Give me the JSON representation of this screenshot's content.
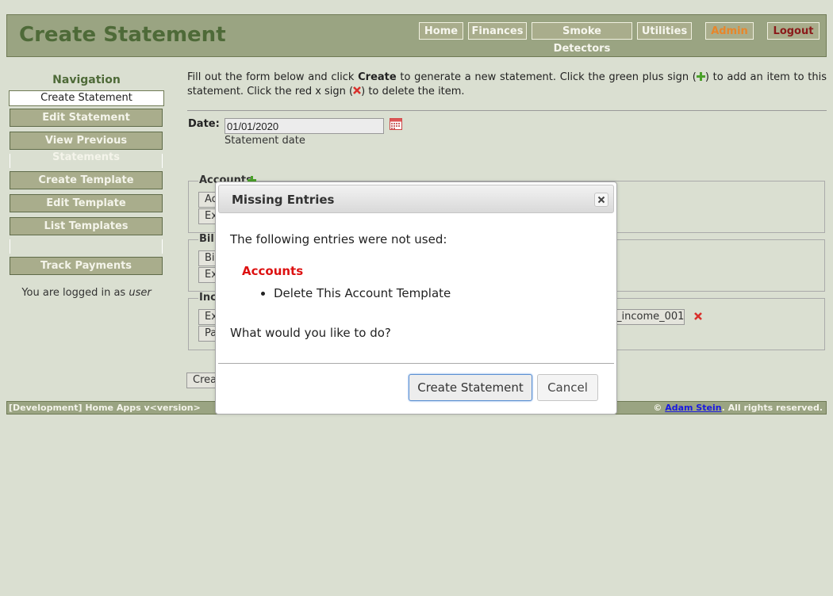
{
  "header": {
    "title": "Create Statement",
    "nav": [
      {
        "label": "Home",
        "color": "#f6f6ee"
      },
      {
        "label": "Finances",
        "color": "#f6f6ee"
      },
      {
        "label": "Smoke Detectors",
        "color": "#f6f6ee"
      },
      {
        "label": "Utilities",
        "color": "#f6f6ee"
      },
      {
        "label": "Admin",
        "color": "#e8862a"
      },
      {
        "label": "Logout",
        "color": "#8b1a1a"
      }
    ]
  },
  "sidebar": {
    "heading": "Navigation",
    "items": [
      {
        "label": "Create Statement",
        "active": true
      },
      {
        "label": "Edit Statement"
      },
      {
        "label": "View Previous Statements"
      },
      {
        "label": "Create Template"
      },
      {
        "label": "Edit Template"
      },
      {
        "label": "List Templates"
      },
      {
        "label": "Track Payments"
      }
    ],
    "logged_in_prefix": "You are logged in as ",
    "logged_in_user": "user"
  },
  "main": {
    "intro": {
      "part1": "Fill out the form below and click ",
      "create_word": "Create",
      "part2": " to generate a new statement. Click the green plus sign (",
      "part3": ") to add an item to this statement. Click the red x sign (",
      "part4": ") to delete the item."
    },
    "date_label": "Date:",
    "date_value": "01/01/2020",
    "date_help": "Statement date",
    "groups": {
      "accounts": {
        "legend": "Accounts",
        "buttons": [
          "Ac",
          "Ex"
        ]
      },
      "bills": {
        "legend": "Bill",
        "buttons": [
          "Bil",
          "Ex"
        ]
      },
      "income": {
        "legend": "Inc",
        "buttons": [
          "Ex",
          "Pa"
        ],
        "field_text": "_income_001"
      }
    },
    "create_button_partial": "Crea"
  },
  "footer": {
    "left": "[Development] Home Apps v<version>",
    "copyright": "© ",
    "author": "Adam Stein",
    "rights": ". All rights reserved."
  },
  "dialog": {
    "title": "Missing Entries",
    "message": "The following entries were not used:",
    "section": "Accounts",
    "entries": [
      "Delete This Account Template"
    ],
    "question": "What would you like to do?",
    "primary_button": "Create Statement",
    "secondary_button": "Cancel"
  },
  "colors": {
    "background": "#dadfd1",
    "header_bg": "#9aa482",
    "title_green": "#4e6a38",
    "error_red": "#dd1111",
    "link_blue": "#1a1ae0"
  }
}
